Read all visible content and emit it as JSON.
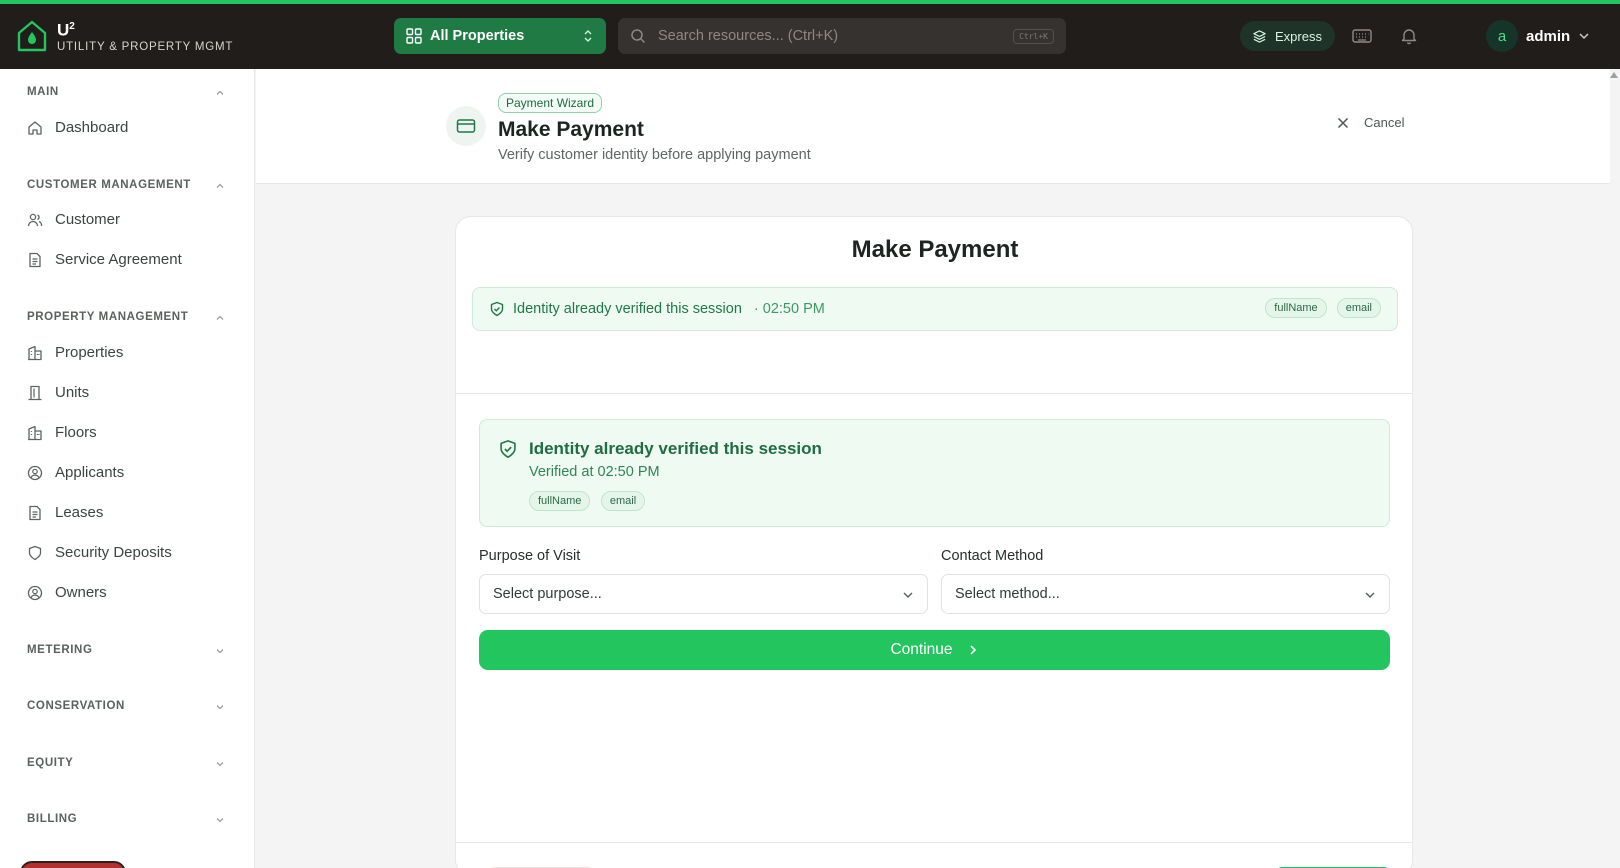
{
  "brand": {
    "name": "U",
    "sup": "2",
    "subtitle": "UTILITY & PROPERTY MGMT"
  },
  "topbar": {
    "property_selector": "All Properties",
    "search_placeholder": "Search resources... (Ctrl+K)",
    "search_shortcut": "Ctrl+K",
    "express_label": "Express",
    "user_initial": "a",
    "user_name": "admin"
  },
  "sidebar": {
    "sections": {
      "main": "MAIN",
      "customer": "CUSTOMER MANAGEMENT",
      "property": "PROPERTY MANAGEMENT",
      "metering": "METERING",
      "conservation": "CONSERVATION",
      "equity": "EQUITY",
      "billing": "BILLING"
    },
    "items": {
      "dashboard": "Dashboard",
      "customer": "Customer",
      "service_agreement": "Service Agreement",
      "properties": "Properties",
      "units": "Units",
      "floors": "Floors",
      "applicants": "Applicants",
      "leases": "Leases",
      "security_deposits": "Security Deposits",
      "owners": "Owners"
    }
  },
  "header": {
    "tag": "Payment Wizard",
    "title": "Make Payment",
    "subtitle": "Verify customer identity before applying payment",
    "cancel_label": "Cancel"
  },
  "card": {
    "title": "Make Payment",
    "verified_bar": {
      "text": "Identity already verified this session",
      "time": "· 02:50 PM",
      "chips": [
        "fullName",
        "email"
      ]
    },
    "verified_box": {
      "title": "Identity already verified this session",
      "subtitle": "Verified at 02:50 PM",
      "chips": [
        "fullName",
        "email"
      ]
    },
    "purpose": {
      "label": "Purpose of Visit",
      "value": "Select purpose..."
    },
    "contact": {
      "label": "Contact Method",
      "value": "Select method..."
    },
    "continue_label": "Continue"
  },
  "colors": {
    "accent": "#22c55e",
    "topbar": "#211d1a",
    "success_bg": "#effaf3",
    "success_text": "#1e7a44"
  }
}
